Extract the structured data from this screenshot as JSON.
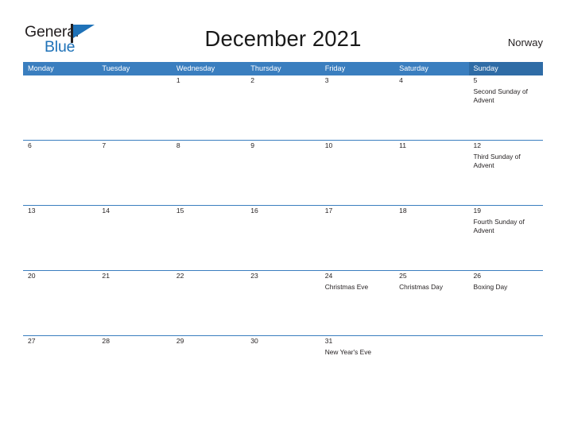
{
  "brand": {
    "name_part1": "General",
    "name_part2": "Blue",
    "flag_icon": "blue-flag-triangle-icon",
    "color_dark": "#231f20",
    "color_blue": "#1f72b8"
  },
  "header": {
    "month_title": "December 2021",
    "country": "Norway"
  },
  "calendar": {
    "header_color": "#3a7ebf",
    "sunday_header_color": "#2f6ca6",
    "stripe_color": "#efefef",
    "weekdays": [
      "Monday",
      "Tuesday",
      "Wednesday",
      "Thursday",
      "Friday",
      "Saturday",
      "Sunday"
    ],
    "weeks": [
      {
        "days": [
          {
            "num": "",
            "events": []
          },
          {
            "num": "",
            "events": []
          },
          {
            "num": "1",
            "events": []
          },
          {
            "num": "2",
            "events": []
          },
          {
            "num": "3",
            "events": []
          },
          {
            "num": "4",
            "events": []
          },
          {
            "num": "5",
            "events": [
              "Second Sunday of Advent"
            ]
          }
        ]
      },
      {
        "days": [
          {
            "num": "6",
            "events": []
          },
          {
            "num": "7",
            "events": []
          },
          {
            "num": "8",
            "events": []
          },
          {
            "num": "9",
            "events": []
          },
          {
            "num": "10",
            "events": []
          },
          {
            "num": "11",
            "events": []
          },
          {
            "num": "12",
            "events": [
              "Third Sunday of Advent"
            ]
          }
        ]
      },
      {
        "days": [
          {
            "num": "13",
            "events": []
          },
          {
            "num": "14",
            "events": []
          },
          {
            "num": "15",
            "events": []
          },
          {
            "num": "16",
            "events": []
          },
          {
            "num": "17",
            "events": []
          },
          {
            "num": "18",
            "events": []
          },
          {
            "num": "19",
            "events": [
              "Fourth Sunday of Advent"
            ]
          }
        ]
      },
      {
        "days": [
          {
            "num": "20",
            "events": []
          },
          {
            "num": "21",
            "events": []
          },
          {
            "num": "22",
            "events": []
          },
          {
            "num": "23",
            "events": []
          },
          {
            "num": "24",
            "events": [
              "Christmas Eve"
            ]
          },
          {
            "num": "25",
            "events": [
              "Christmas Day"
            ]
          },
          {
            "num": "26",
            "events": [
              "Boxing Day"
            ]
          }
        ]
      },
      {
        "days": [
          {
            "num": "27",
            "events": []
          },
          {
            "num": "28",
            "events": []
          },
          {
            "num": "29",
            "events": []
          },
          {
            "num": "30",
            "events": []
          },
          {
            "num": "31",
            "events": [
              "New Year's Eve"
            ]
          },
          {
            "num": "",
            "events": []
          },
          {
            "num": "",
            "events": []
          }
        ]
      }
    ]
  }
}
